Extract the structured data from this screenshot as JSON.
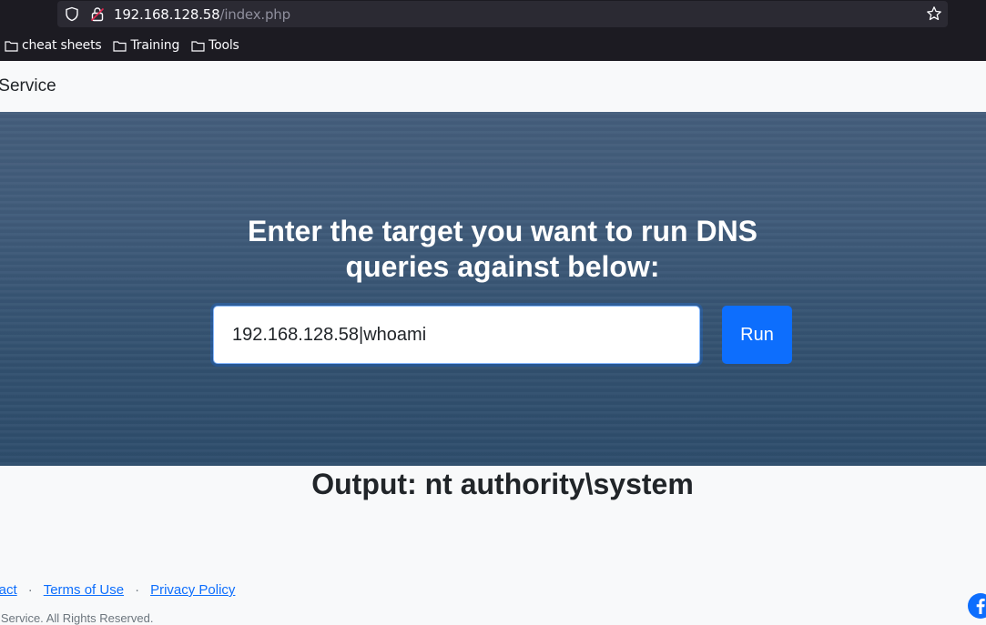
{
  "browser": {
    "url_host": "192.168.128.58",
    "url_path": "/index.php",
    "bookmarks": [
      {
        "label": "cheat sheets"
      },
      {
        "label": "Training"
      },
      {
        "label": "Tools"
      }
    ]
  },
  "navbar": {
    "brand": "Ping Service"
  },
  "hero": {
    "title_line1": "Enter the target you want to run DNS",
    "title_line2": "queries against below:",
    "input_value": "192.168.128.58|whoami",
    "run_label": "Run"
  },
  "output": {
    "text": "Output: nt authority\\system"
  },
  "footer": {
    "links": [
      "Contact",
      "Terms of Use",
      "Privacy Policy"
    ],
    "separator": "·",
    "copyright": "Ping Service. All Rights Reserved."
  },
  "colors": {
    "accent": "#0d6efd",
    "chrome_bg": "#1c1b22",
    "urlbar_bg": "#2b2a33"
  }
}
